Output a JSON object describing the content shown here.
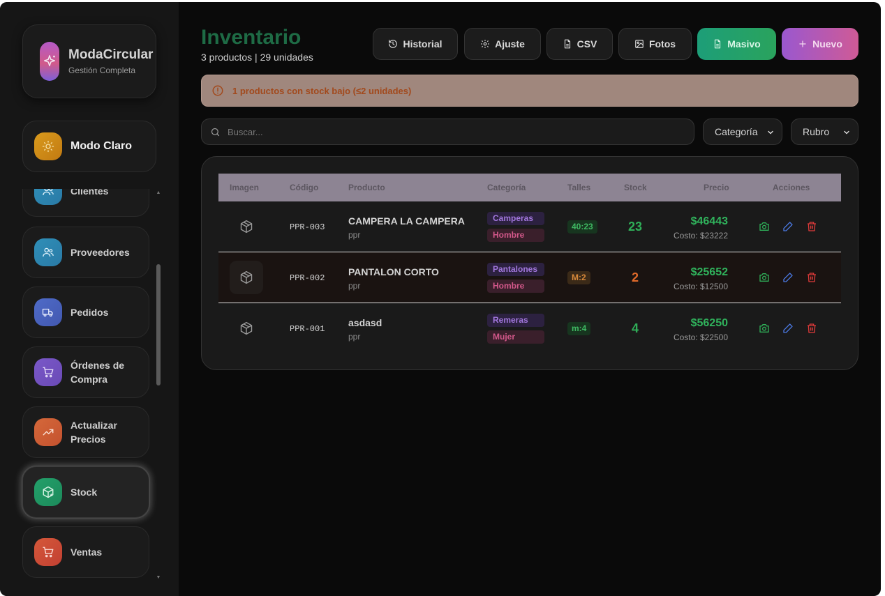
{
  "brand": {
    "name": "ModaCircular",
    "subtitle": "Gestión Completa"
  },
  "mode_toggle": {
    "label": "Modo Claro"
  },
  "nav": {
    "clientes": "Clientes",
    "proveedores": "Proveedores",
    "pedidos": "Pedidos",
    "ordenes": "Órdenes de Compra",
    "actualizar": "Actualizar Precios",
    "stock": "Stock",
    "ventas": "Ventas"
  },
  "header": {
    "title": "Inventario",
    "summary": "3 productos | 29 unidades"
  },
  "toolbar": {
    "historial": "Historial",
    "ajuste": "Ajuste",
    "csv": "CSV",
    "fotos": "Fotos",
    "masivo": "Masivo",
    "nuevo": "Nuevo"
  },
  "alert": {
    "text": "1 productos con stock bajo (≤2 unidades)"
  },
  "search": {
    "placeholder": "Buscar..."
  },
  "filters": {
    "categoria": "Categoría",
    "rubro": "Rubro"
  },
  "table": {
    "headers": {
      "imagen": "Imagen",
      "codigo": "Código",
      "producto": "Producto",
      "categoria": "Categoría",
      "talles": "Talles",
      "stock": "Stock",
      "precio": "Precio",
      "acciones": "Acciones"
    },
    "rows": [
      {
        "code": "PPR-003",
        "name": "CAMPERA LA CAMPERA",
        "sub": "ppr",
        "category": "Camperas",
        "rubro": "Hombre",
        "sizes": "40:23",
        "stock": "23",
        "price": "$46443",
        "cost": "Costo: $23222"
      },
      {
        "code": "PPR-002",
        "name": "PANTALON CORTO",
        "sub": "ppr",
        "category": "Pantalones",
        "rubro": "Hombre",
        "sizes": "M:2",
        "stock": "2",
        "price": "$25652",
        "cost": "Costo: $12500"
      },
      {
        "code": "PPR-001",
        "name": "asdasd",
        "sub": "ppr",
        "category": "Remeras",
        "rubro": "Mujer",
        "sizes": "m:4",
        "stock": "4",
        "price": "$56250",
        "cost": "Costo: $22500"
      }
    ]
  },
  "colors": {
    "title": "#1e6b45",
    "price": "#30b35c",
    "stock_low": "#e06a2a",
    "masivo_button": "#1d9e78",
    "nuevo_button": "#9a58cf"
  }
}
